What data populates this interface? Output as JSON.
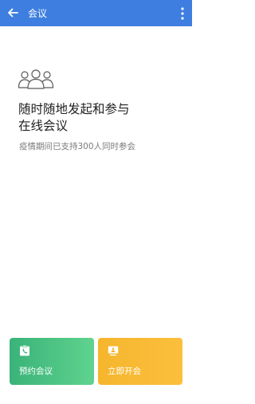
{
  "header": {
    "title": "会议",
    "back_icon": "arrow-left-icon",
    "more_icon": "more-vertical-icon",
    "background": "#3d7ee0"
  },
  "hero": {
    "icon": "people-group-icon",
    "headline_line1": "随时随地发起和参与",
    "headline_line2": "在线会议",
    "subtitle": "疫情期间已支持300人同时参会"
  },
  "actions": [
    {
      "label": "预约会议",
      "icon": "clipboard-phone-icon",
      "color": "#3ab379"
    },
    {
      "label": "立即开会",
      "icon": "presentation-screen-icon",
      "color": "#f5b62e"
    }
  ]
}
